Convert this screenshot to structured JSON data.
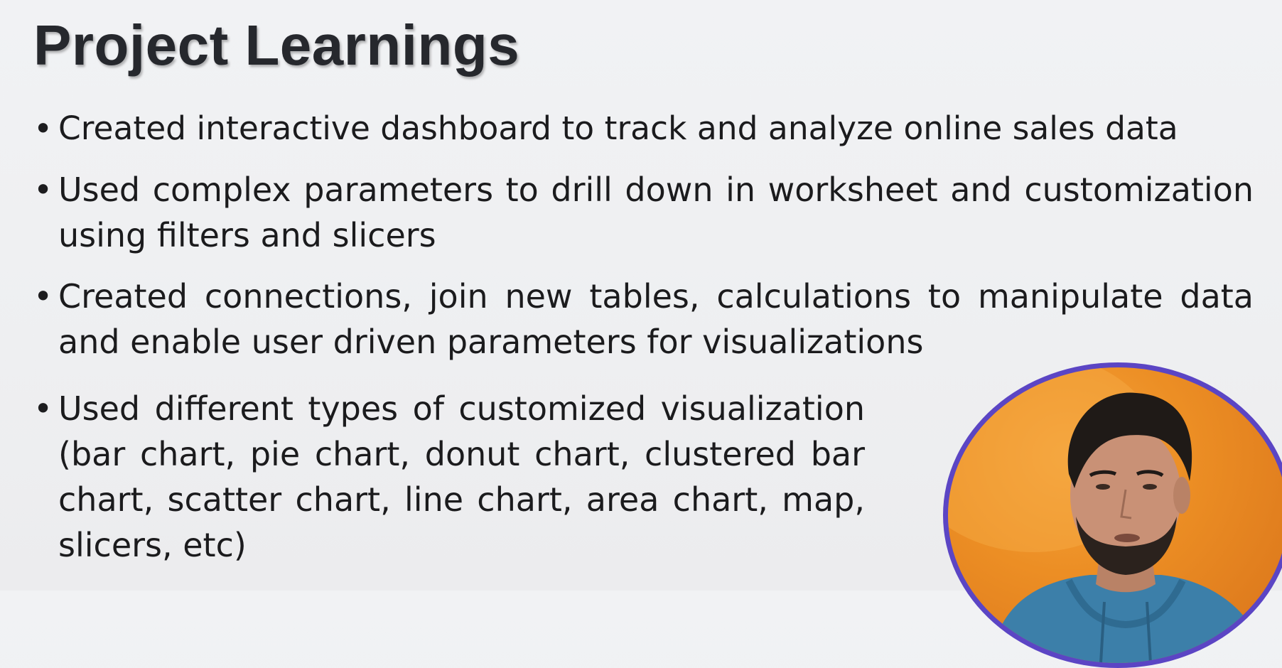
{
  "slide": {
    "title": "Project Learnings",
    "bullets": [
      "Created interactive dashboard to track and analyze online sales data",
      "Used complex parameters to drill down in worksheet and customization using filters and slicers",
      "Created connections, join new tables, calculations to manipulate data and enable user driven parameters for visualizations",
      "Used different types of customized visualization (bar chart, pie chart, donut chart, clustered bar chart, scatter chart, line chart, area chart, map, slicers, etc)"
    ],
    "bullet_symbol": "•"
  },
  "webcam": {
    "icon": "presenter-webcam",
    "border_color": "#5b45c4",
    "background_color": "#ec8e24"
  }
}
